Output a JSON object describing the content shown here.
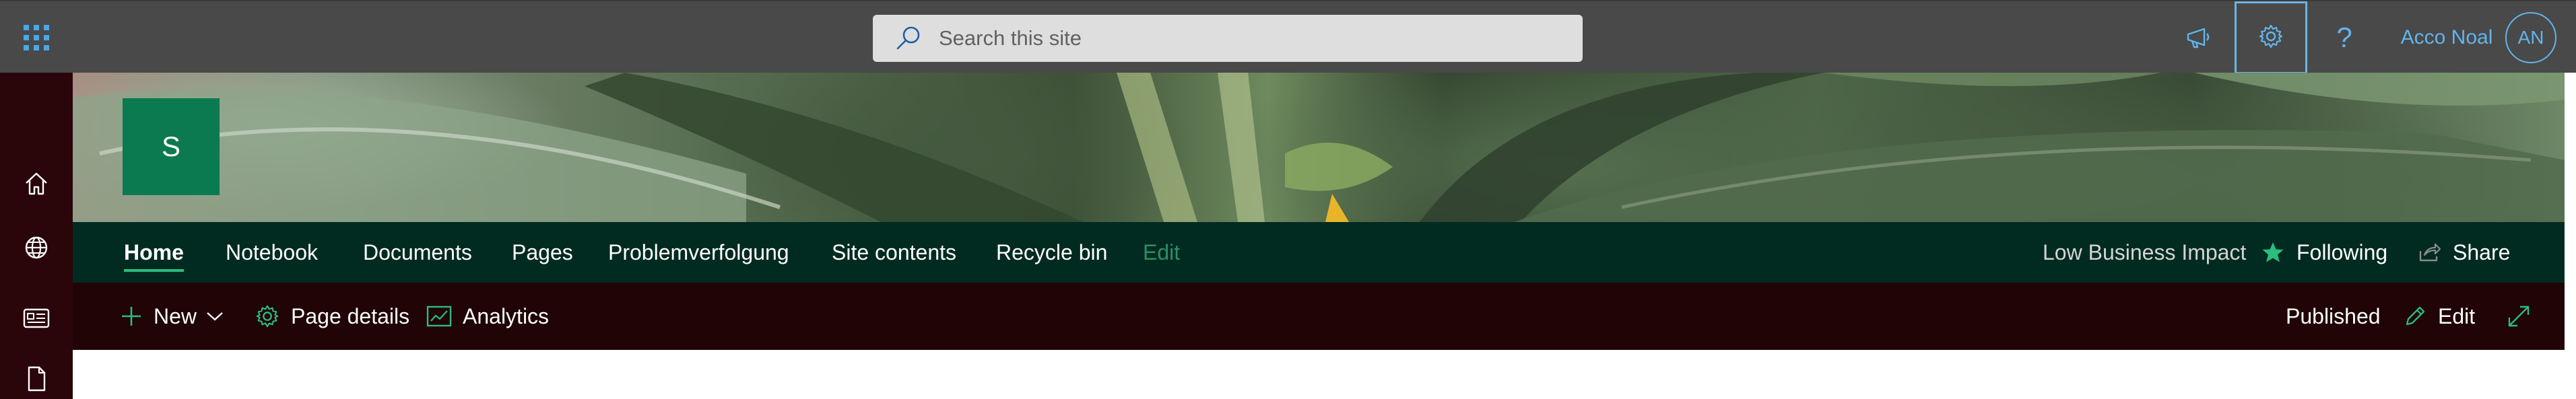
{
  "suite_bar": {
    "app_launcher_icon": "waffle-icon",
    "search": {
      "placeholder": "Search this site",
      "icon": "search-icon"
    },
    "megaphone_icon": "megaphone-icon",
    "settings_icon": "gear-icon",
    "help_label": "?",
    "user_name": "Acco Noal",
    "avatar_initials": "AN"
  },
  "app_bar": {
    "items": [
      {
        "icon": "home-icon"
      },
      {
        "icon": "globe-icon"
      },
      {
        "icon": "news-icon"
      },
      {
        "icon": "document-icon"
      }
    ]
  },
  "site": {
    "logo_letter": "S",
    "logo_color": "#0b7a50"
  },
  "nav": {
    "items": [
      {
        "label": "Home",
        "active": true
      },
      {
        "label": "Notebook"
      },
      {
        "label": "Documents"
      },
      {
        "label": "Pages"
      },
      {
        "label": "Problemverfolgung"
      },
      {
        "label": "Site contents"
      },
      {
        "label": "Recycle bin"
      },
      {
        "label": "Edit"
      }
    ],
    "classification": "Low Business Impact",
    "following_label": "Following",
    "share_label": "Share"
  },
  "command_bar": {
    "new_label": "New",
    "page_details_label": "Page details",
    "analytics_label": "Analytics",
    "status": "Published",
    "edit_label": "Edit",
    "expand_icon": "expand-icon"
  },
  "colors": {
    "suite_bar": "#494949",
    "accent_blue": "#62b5ec",
    "nav_background": "#012b20",
    "command_bar_background": "#200406",
    "app_bar_background": "#2a0509",
    "accent_green": "#2bbd7e"
  }
}
